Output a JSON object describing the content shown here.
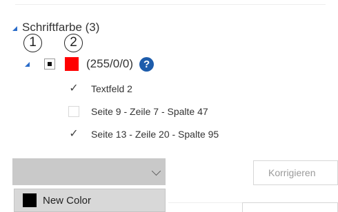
{
  "group": {
    "label": "Schriftfarbe (3)"
  },
  "callouts": [
    "1",
    "2"
  ],
  "color_entry": {
    "value": "(255/0/0)",
    "swatch_color": "#ff0000"
  },
  "items": [
    {
      "label": "Textfeld 2",
      "checked": true
    },
    {
      "label": "Seite 9 - Zeile 7 - Spalte 47",
      "checked": false
    },
    {
      "label": "Seite 13 - Zeile 20 - Spalte 95",
      "checked": true
    }
  ],
  "dropdown": {
    "selected": "",
    "option_label": "New Color",
    "option_color": "#000000"
  },
  "buttons": {
    "correct": "Korrigieren"
  },
  "icons": {
    "help": "?",
    "check": "✓"
  }
}
